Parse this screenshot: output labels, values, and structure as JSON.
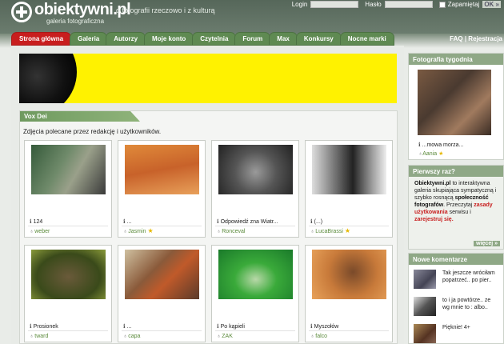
{
  "site": {
    "logo": "obiektywni.pl",
    "logo_sub": "galeria fotograficzna",
    "tagline": "o fotografii rzeczowo i z kulturą"
  },
  "login": {
    "login_label": "Login",
    "password_label": "Hasło",
    "remember_label": "Zapamiętaj",
    "ok_label": "OK »"
  },
  "nav": {
    "tabs": [
      {
        "label": "Strona główna"
      },
      {
        "label": "Galeria"
      },
      {
        "label": "Autorzy"
      },
      {
        "label": "Moje konto"
      },
      {
        "label": "Czytelnia"
      },
      {
        "label": "Forum"
      },
      {
        "label": "Max"
      },
      {
        "label": "Konkursy"
      },
      {
        "label": "Nocne marki"
      }
    ],
    "right": "FAQ | Rejestracja"
  },
  "vox": {
    "title": "Vox Dei",
    "subtitle": "Zdjęcia polecane przez redakcję i użytkowników.",
    "cards": [
      {
        "title": "124",
        "user": "weber",
        "star": ""
      },
      {
        "title": "...",
        "user": "Jasmin",
        "star": "★"
      },
      {
        "title": "Odpowiedź zna Wiatr...",
        "user": "Ronceval",
        "star": ""
      },
      {
        "title": "(...)",
        "user": "LucaBrassi",
        "star": "★"
      },
      {
        "title": "Prosionek",
        "user": "tward",
        "star": ""
      },
      {
        "title": "...",
        "user": "capa",
        "star": ""
      },
      {
        "title": "Po kąpieli",
        "user": "ZAK",
        "star": ""
      },
      {
        "title": "Myszołów",
        "user": "falco",
        "star": ""
      }
    ]
  },
  "sidebar": {
    "photo_of_week": {
      "header": "Fotografia tygodnia",
      "title": "...mowa morza...",
      "user": "Aania",
      "star": "★"
    },
    "first_time": {
      "header": "Pierwszy raz?",
      "p1": "Obiektywni.pl",
      "p2": " to interaktywna galeria skupiająca sympatyczną i szybko rosnącą ",
      "p3": "społeczność fotografów",
      "p4": ". Przeczytaj ",
      "p5": "zasady użytkowania",
      "p6": " serwisu i ",
      "p7": "zarejestruj się.",
      "more": "więcej »"
    },
    "comments": {
      "header": "Nowe komentarze",
      "items": [
        {
          "text": "Tak jeszcze wróciłam popatrzeć.. po pier.."
        },
        {
          "text": "to i ja powtórze.. ze wg mnie to : albo.."
        },
        {
          "text": "Pięknie! 4+"
        }
      ]
    }
  }
}
